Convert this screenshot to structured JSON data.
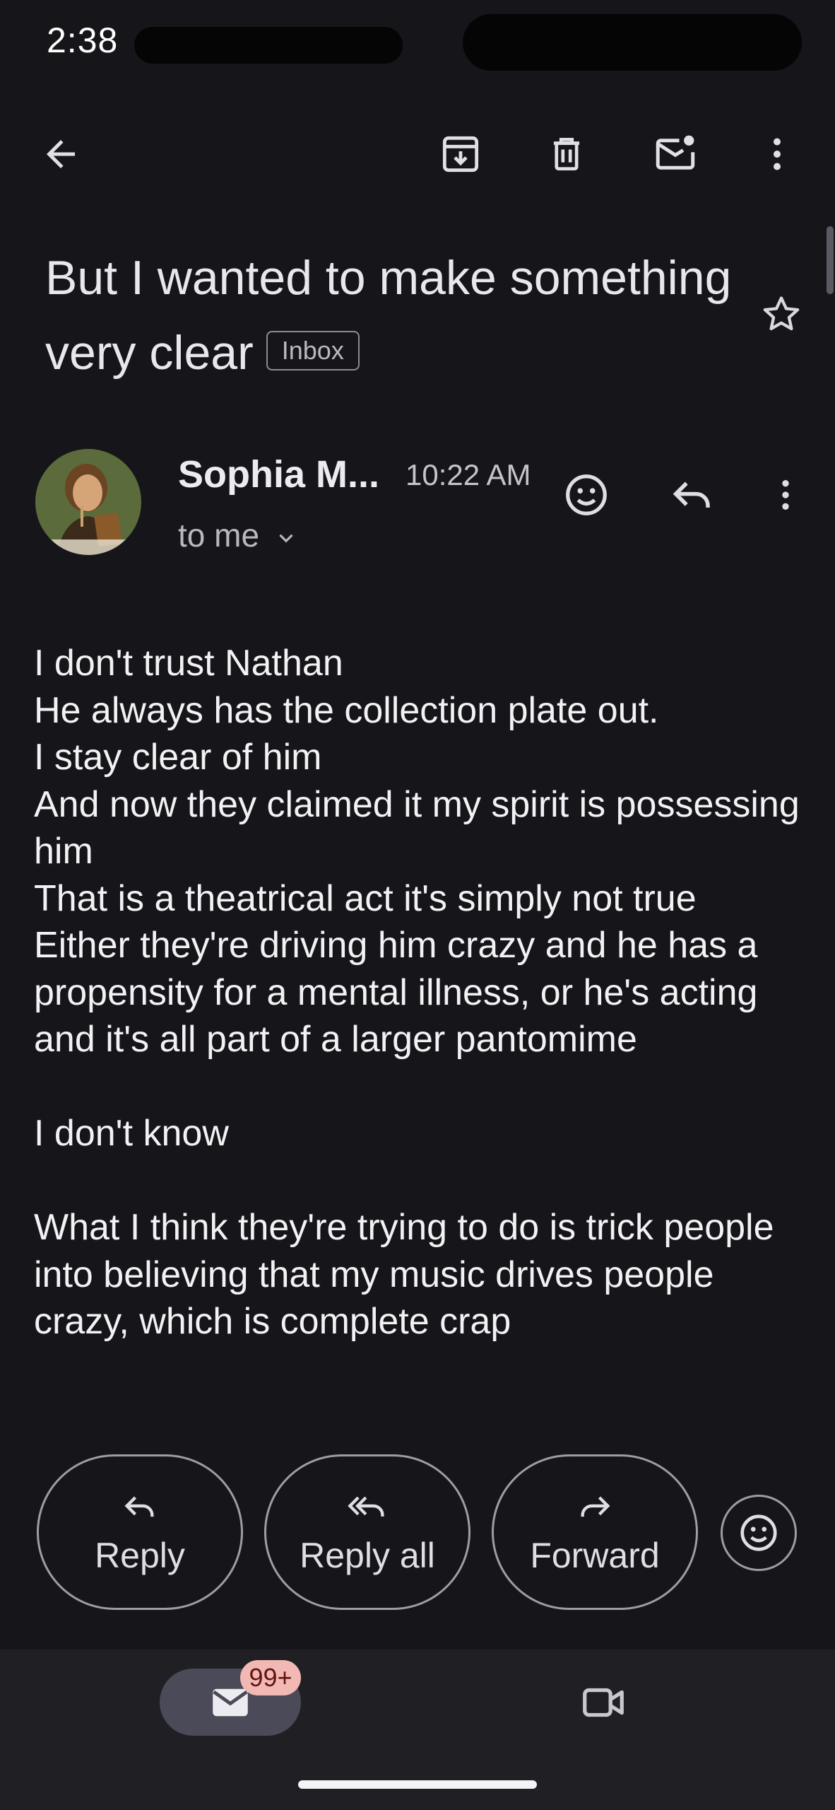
{
  "status_bar": {
    "time": "2:38"
  },
  "subject": {
    "text": "But I wanted to make something very clear",
    "label": "Inbox"
  },
  "sender": {
    "name": "Sophia M...",
    "time": "10:22 AM",
    "recipient": "to me"
  },
  "body": {
    "text": "I don't trust Nathan\nHe always has the collection plate out.\nI stay clear of him\nAnd now they claimed it my spirit is possessing him\nThat is a theatrical act it's simply not true\nEither they're driving him crazy and he has a propensity for a mental illness, or he's acting and it's all part of a larger pantomime\n\nI don't know\n\nWhat I think they're trying to do is trick people into believing that my music drives people crazy, which is complete crap"
  },
  "actions": {
    "reply": "Reply",
    "reply_all": "Reply all",
    "forward": "Forward"
  },
  "bottom_nav": {
    "mail_badge": "99+"
  },
  "colors": {
    "background": "#16161a",
    "bottom_nav": "#1f1f24",
    "mail_pill": "#4a4a58",
    "badge": "#f2b8b3",
    "text": "#e6e6ea"
  },
  "icons": {
    "toolbar": [
      "arrow-back-icon",
      "archive-icon",
      "delete-icon",
      "mark-unread-icon",
      "more-vert-icon"
    ],
    "subject": [
      "star-icon"
    ],
    "sender": [
      "add-reaction-icon",
      "reply-icon",
      "more-vert-icon",
      "chevron-down-icon"
    ],
    "actions": [
      "reply-icon",
      "reply-all-icon",
      "forward-icon",
      "add-reaction-icon"
    ],
    "bottom_nav": [
      "mail-icon",
      "video-icon"
    ]
  }
}
